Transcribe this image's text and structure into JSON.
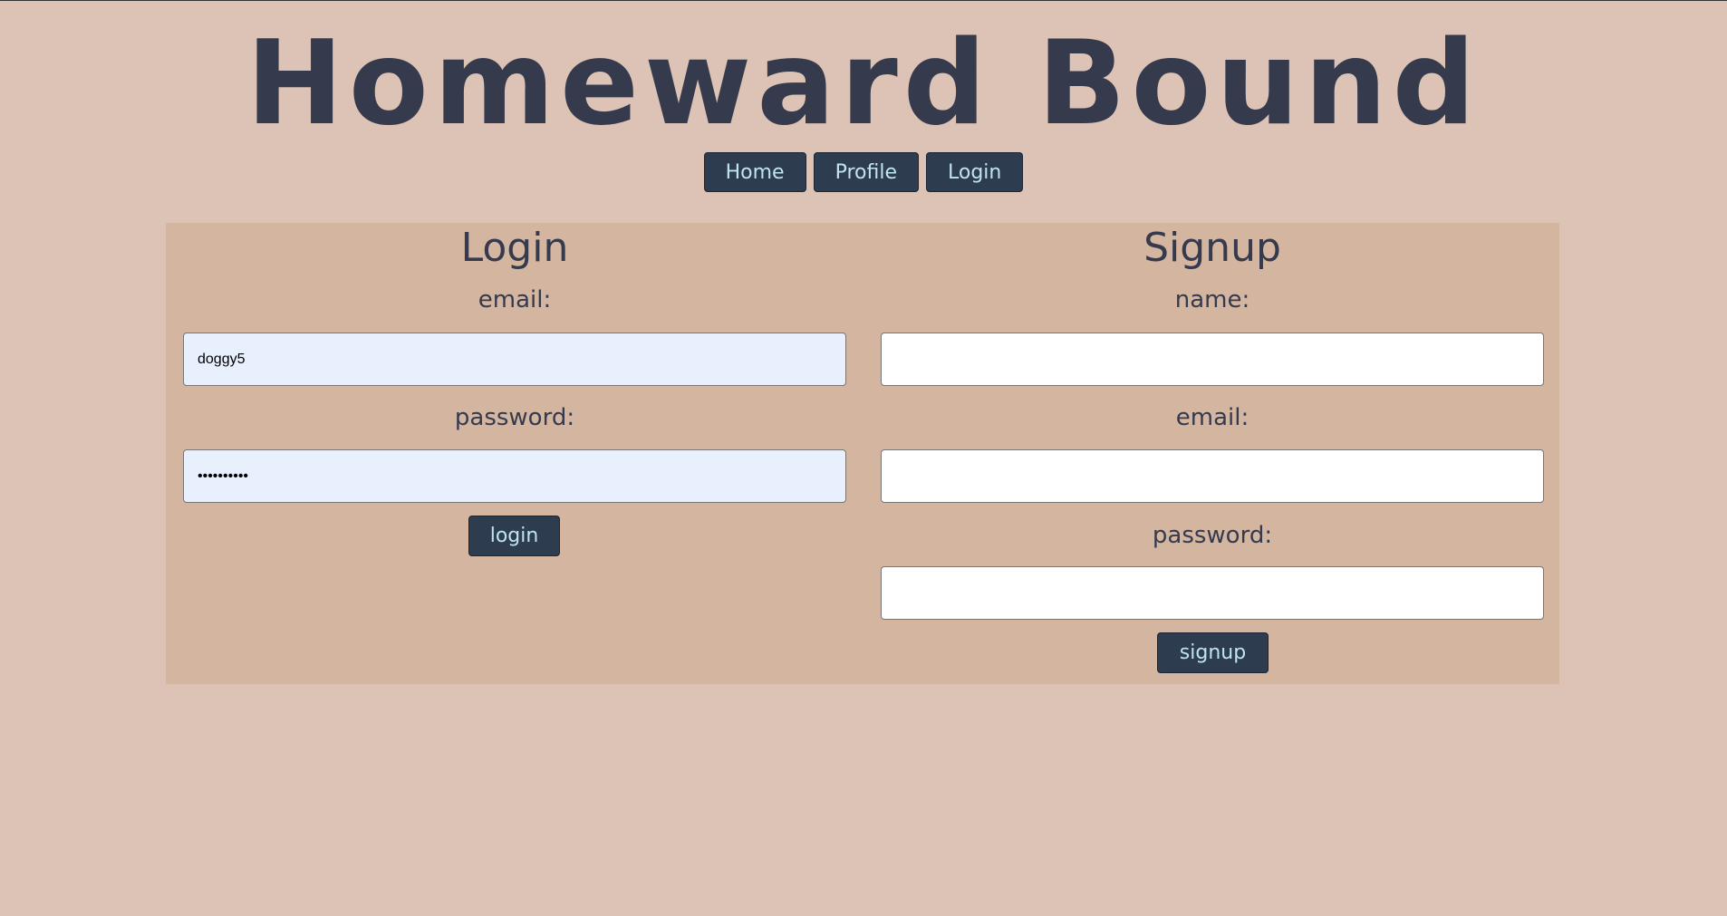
{
  "header": {
    "title": "Homeward Bound"
  },
  "nav": {
    "items": [
      {
        "label": "Home"
      },
      {
        "label": "Profile"
      },
      {
        "label": "Login"
      }
    ]
  },
  "login": {
    "title": "Login",
    "email_label": "email:",
    "email_value": "doggy5",
    "password_label": "password:",
    "password_value": "••••••••••",
    "button_label": "login"
  },
  "signup": {
    "title": "Signup",
    "name_label": "name:",
    "name_value": "",
    "email_label": "email:",
    "email_value": "",
    "password_label": "password:",
    "password_value": "",
    "button_label": "signup"
  },
  "colors": {
    "page_background": "#dcc3b5",
    "panel_background": "#d4b5a0",
    "text": "#353a4d",
    "button_background": "#2e3c50",
    "button_text": "#bfe3f2",
    "autofill_background": "#e8f0fe"
  }
}
